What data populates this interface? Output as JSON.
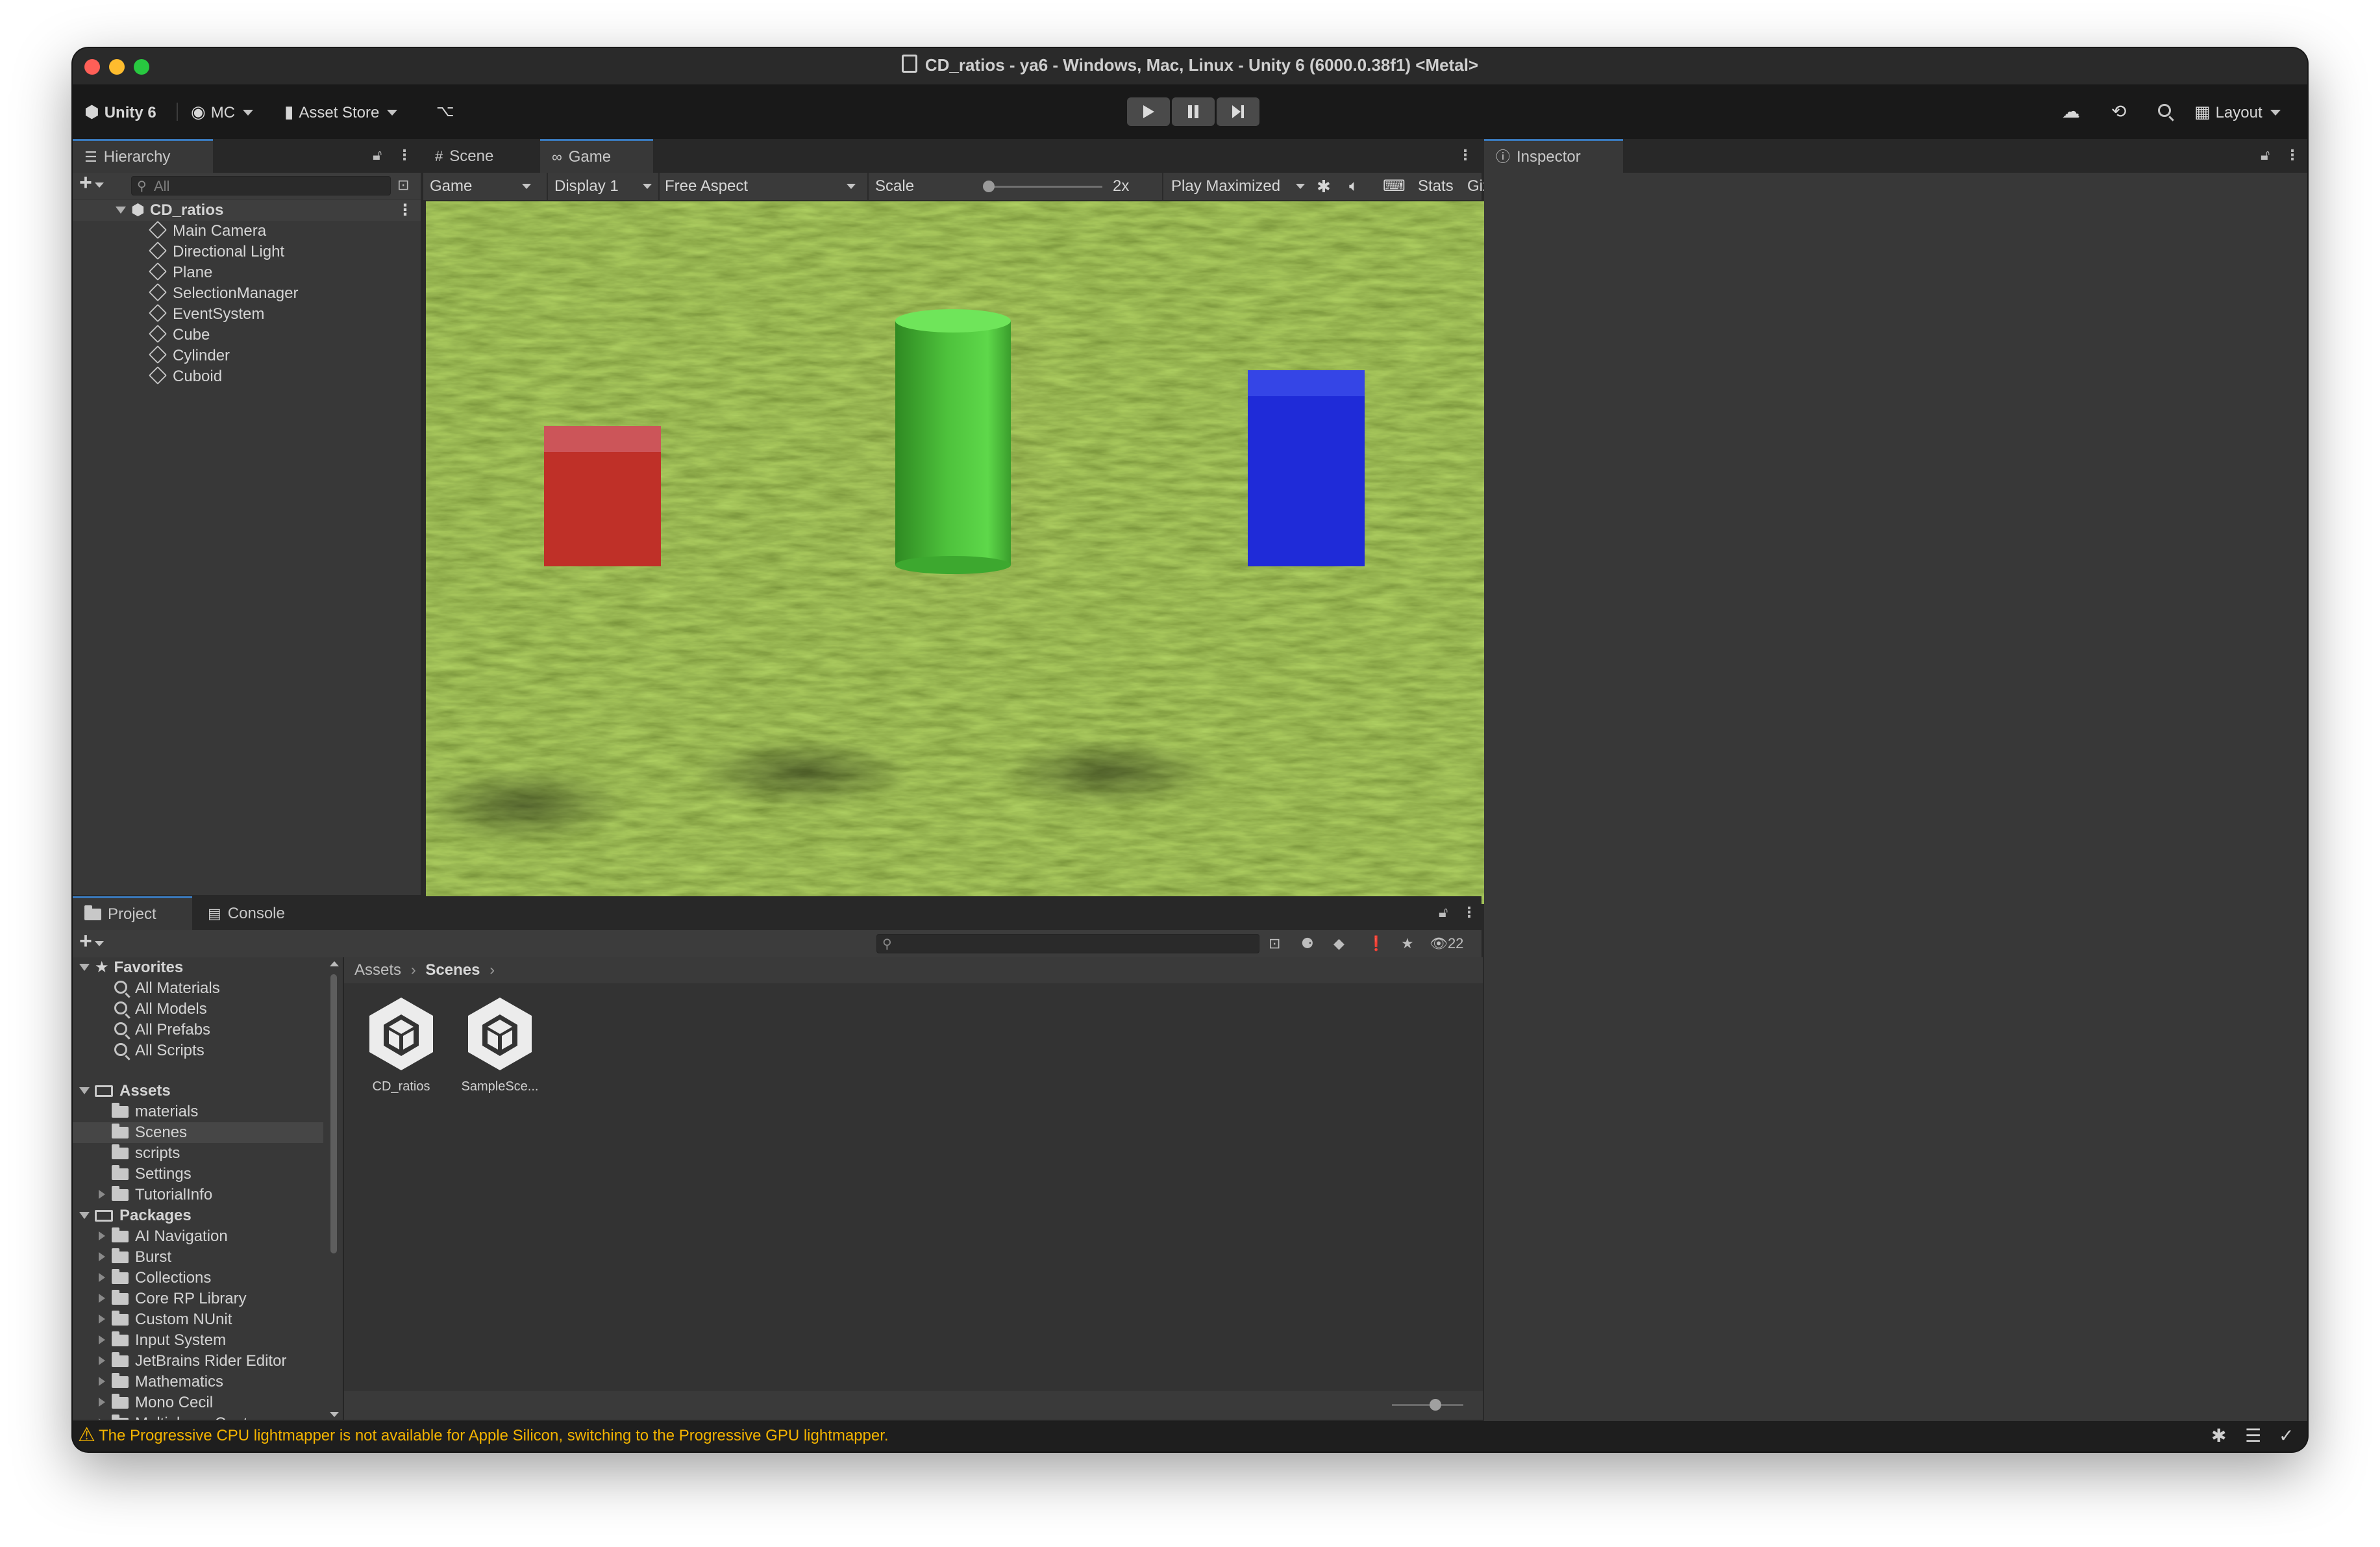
{
  "window": {
    "title": "CD_ratios - ya6 - Windows, Mac, Linux - Unity 6 (6000.0.38f1) <Metal>",
    "traffic_lights": {
      "close": "#ff5f57",
      "minimize": "#febc2e",
      "zoom": "#28c840"
    }
  },
  "toolbar": {
    "unity_label": "Unity 6",
    "account_label": "MC",
    "asset_store_label": "Asset Store",
    "play_icon": "play-icon",
    "pause_icon": "pause-icon",
    "step_icon": "step-icon",
    "layout_label": "Layout"
  },
  "hierarchy": {
    "tab_label": "Hierarchy",
    "search_placeholder": "All",
    "scene_name": "CD_ratios",
    "items": [
      "Main Camera",
      "Directional Light",
      "Plane",
      "SelectionManager",
      "EventSystem",
      "Cube",
      "Cylinder",
      "Cuboid"
    ]
  },
  "center": {
    "tabs": [
      "Scene",
      "Game"
    ],
    "active_tab": "Game",
    "game_toolbar": {
      "view_select": "Game",
      "display_select": "Display 1",
      "aspect_select": "Free Aspect",
      "scale_label": "Scale",
      "scale_value": "2x",
      "play_mode_select": "Play Maximized",
      "stats_label": "Stats",
      "gizmos_label": "Gizmos"
    },
    "scene_objects": [
      {
        "name": "red cube",
        "color": "#bf3028"
      },
      {
        "name": "green cylinder",
        "color": "#4ec23c"
      },
      {
        "name": "blue cuboid",
        "color": "#1f2bd8"
      }
    ],
    "ground_color": "#5c7a1e"
  },
  "inspector": {
    "tab_label": "Inspector"
  },
  "project": {
    "tabs": [
      "Project",
      "Console"
    ],
    "active_tab": "Project",
    "hidden_count": "22",
    "favorites_label": "Favorites",
    "favorites": [
      "All Materials",
      "All Models",
      "All Prefabs",
      "All Scripts"
    ],
    "assets_label": "Assets",
    "assets": [
      {
        "label": "materials",
        "expandable": false,
        "selected": false
      },
      {
        "label": "Scenes",
        "expandable": false,
        "selected": true
      },
      {
        "label": "scripts",
        "expandable": false,
        "selected": false
      },
      {
        "label": "Settings",
        "expandable": false,
        "selected": false
      },
      {
        "label": "TutorialInfo",
        "expandable": true,
        "selected": false
      }
    ],
    "packages_label": "Packages",
    "packages": [
      "AI Navigation",
      "Burst",
      "Collections",
      "Core RP Library",
      "Custom NUnit",
      "Input System",
      "JetBrains Rider Editor",
      "Mathematics",
      "Mono Cecil",
      "Multiplayer Center"
    ],
    "breadcrumb": {
      "root": "Assets",
      "current": "Scenes"
    },
    "files": [
      "CD_ratios",
      "SampleSce..."
    ]
  },
  "status": {
    "message": "The Progressive CPU lightmapper is not available for Apple Silicon, switching to the Progressive GPU lightmapper.",
    "warning_color": "#f4b400"
  }
}
